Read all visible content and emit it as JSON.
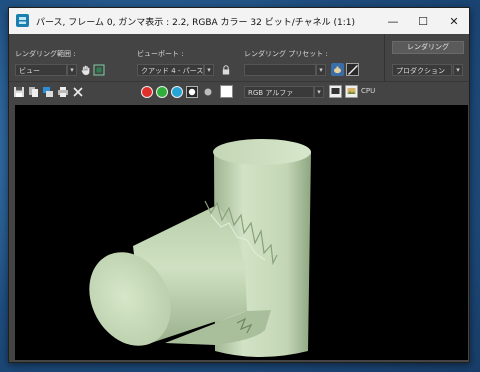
{
  "window": {
    "title": "パース, フレーム 0, ガンマ表示 : 2.2, RGBA カラー 32 ビット/チャネル (1:1)",
    "minimize_glyph": "—",
    "maximize_glyph": "☐",
    "close_glyph": "✕"
  },
  "toolbar": {
    "render_area_label": "レンダリング範囲 :",
    "render_area_value": "ビュー",
    "viewport_label": "ビューポート :",
    "viewport_value": "クアッド 4 - パース",
    "preset_label": "レンダリング プリセット :",
    "preset_value": "",
    "render_button": "レンダリング",
    "production_value": "プロダクション",
    "channel_value": "RGB アルファ",
    "renderer_label": "CPU"
  },
  "colors": {
    "red_channel": "#e0302c",
    "green_channel": "#2fae3a",
    "blue_channel": "#27a3d6",
    "shape_tint": "#c9dcbd",
    "viewport_bg": "#000000"
  },
  "icons": [
    "app-icon",
    "dropdown-arrow-icon",
    "hand-icon",
    "region-icon",
    "lock-icon",
    "teapot-icon",
    "edit-icon",
    "save-icon",
    "copy-icon",
    "clone-icon",
    "print-icon",
    "clear-icon",
    "alpha-icon",
    "mono-icon",
    "white-swatch-icon",
    "display-icon",
    "environment-icon"
  ]
}
